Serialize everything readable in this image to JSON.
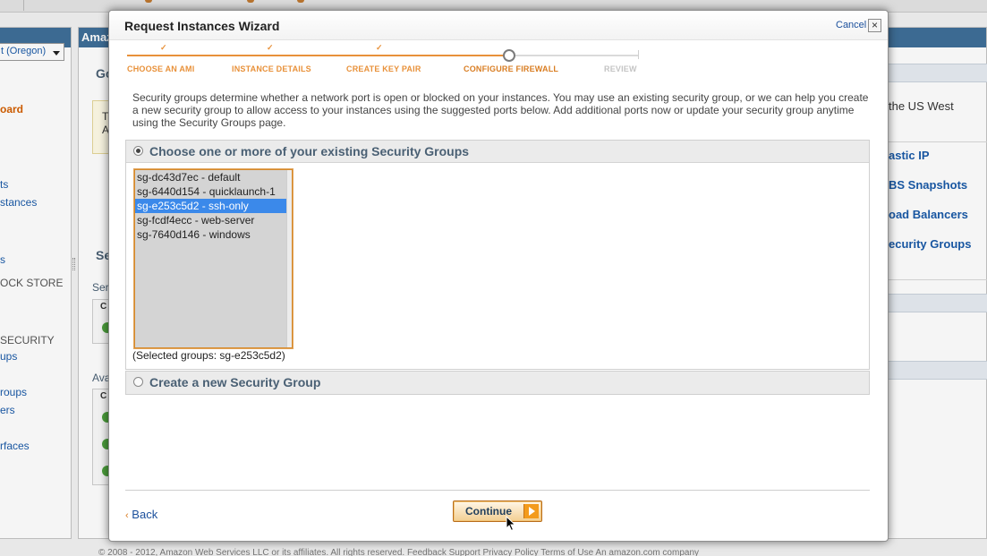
{
  "background": {
    "main_header": "Amaz",
    "region": "t (Oregon)",
    "nav": [
      {
        "text": "oard",
        "active": true
      },
      {
        "text": "ts"
      },
      {
        "text": "stances"
      },
      {
        "text": "s"
      },
      {
        "text": "OCK STORE",
        "head": true
      },
      {
        "text": "SECURITY",
        "head": true
      },
      {
        "text": "ups"
      },
      {
        "text": "roups"
      },
      {
        "text": "ers"
      },
      {
        "text": "rfaces"
      }
    ],
    "main_fragments": {
      "go": "Go",
      "t": "T",
      "a": "A",
      "se": "Se",
      "ser": "Ser",
      "c1": "C",
      "ava": "Ava",
      "c2": "C"
    },
    "right_fragments": {
      "us_west": "the US West",
      "elastic_ip": "astic IP",
      "ebs_snapshots": "BS Snapshots",
      "load_balancers": "oad Balancers",
      "security_groups": "ecurity Groups"
    },
    "footer": "© 2008 - 2012, Amazon Web Services LLC or its affiliates. All rights reserved.   Feedback   Support   Privacy Policy   Terms of Use   An amazon.com company"
  },
  "dialog": {
    "title": "Request Instances Wizard",
    "cancel_label": "Cancel",
    "close_label": "×",
    "steps": [
      {
        "label": "CHOOSE AN AMI",
        "state": "done"
      },
      {
        "label": "INSTANCE DETAILS",
        "state": "done"
      },
      {
        "label": "CREATE KEY PAIR",
        "state": "done"
      },
      {
        "label": "CONFIGURE FIREWALL",
        "state": "current"
      },
      {
        "label": "REVIEW",
        "state": "future"
      }
    ],
    "tick_glyph": "✓",
    "intro": "Security groups determine whether a network port is open or blocked on your instances. You may use an existing security group, or we can help you create a new security group to allow access to your instances using the suggested ports below. Add additional ports now or update your security group anytime using the Security Groups page.",
    "existing_section_title": "Choose one or more of your existing Security Groups",
    "security_groups": [
      {
        "label": "sg-dc43d7ec - default",
        "selected": false
      },
      {
        "label": "sg-6440d154 - quicklaunch-1",
        "selected": false
      },
      {
        "label": "sg-e253c5d2 - ssh-only",
        "selected": true
      },
      {
        "label": "sg-fcdf4ecc - web-server",
        "selected": false
      },
      {
        "label": "sg-7640d146 - windows",
        "selected": false
      }
    ],
    "selected_groups_text": "(Selected groups: sg-e253c5d2)",
    "new_section_title": "Create a new Security Group",
    "back_chevron": "‹",
    "back_label": "Back",
    "continue_label": "Continue",
    "accent_color": "#f39b1c",
    "link_color": "#1a4f9c"
  }
}
